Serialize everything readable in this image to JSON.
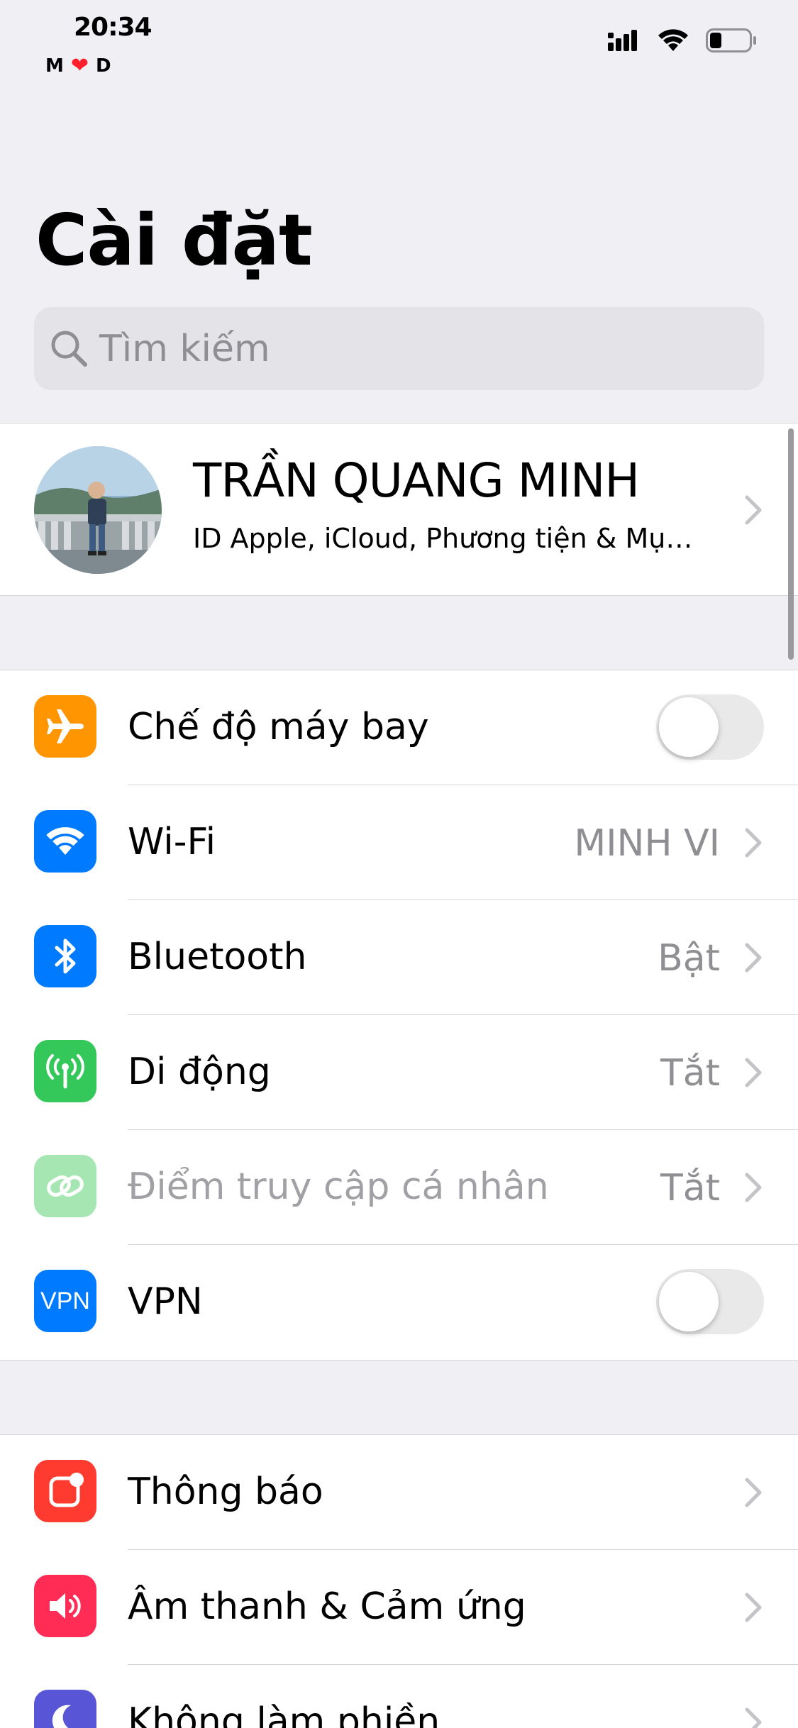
{
  "status_bar": {
    "time": "20:34",
    "carrier_left": "M",
    "carrier_right": "D"
  },
  "title": "Cài đặt",
  "search": {
    "placeholder": "Tìm kiếm"
  },
  "profile": {
    "name": "TRẦN QUANG MINH",
    "subtitle": "ID Apple, iCloud, Phương tiện & Mục..."
  },
  "connectivity": [
    {
      "label": "Chế độ máy bay",
      "icon": "airplane-icon",
      "color": "#ff9500",
      "toggle": "off"
    },
    {
      "label": "Wi-Fi",
      "icon": "wifi-icon",
      "color": "#007aff",
      "value": "MINH VI"
    },
    {
      "label": "Bluetooth",
      "icon": "bluetooth-icon",
      "color": "#007aff",
      "value": "Bật"
    },
    {
      "label": "Di động",
      "icon": "antenna-icon",
      "color": "#34c759",
      "value": "Tắt"
    },
    {
      "label": "Điểm truy cập cá nhân",
      "icon": "hotspot-icon",
      "color": "#a5e6b3",
      "value": "Tắt"
    },
    {
      "label": "VPN",
      "icon": "vpn-icon",
      "color": "#007aff",
      "icon_text": "VPN",
      "toggle": "off"
    }
  ],
  "general": [
    {
      "label": "Thông báo",
      "icon": "notifications-icon",
      "color": "#ff3b30"
    },
    {
      "label": "Âm thanh & Cảm ứng",
      "icon": "speaker-icon",
      "color": "#ff2d55"
    },
    {
      "label": "Không làm phiền",
      "icon": "moon-icon",
      "color": "#5856d6"
    }
  ]
}
